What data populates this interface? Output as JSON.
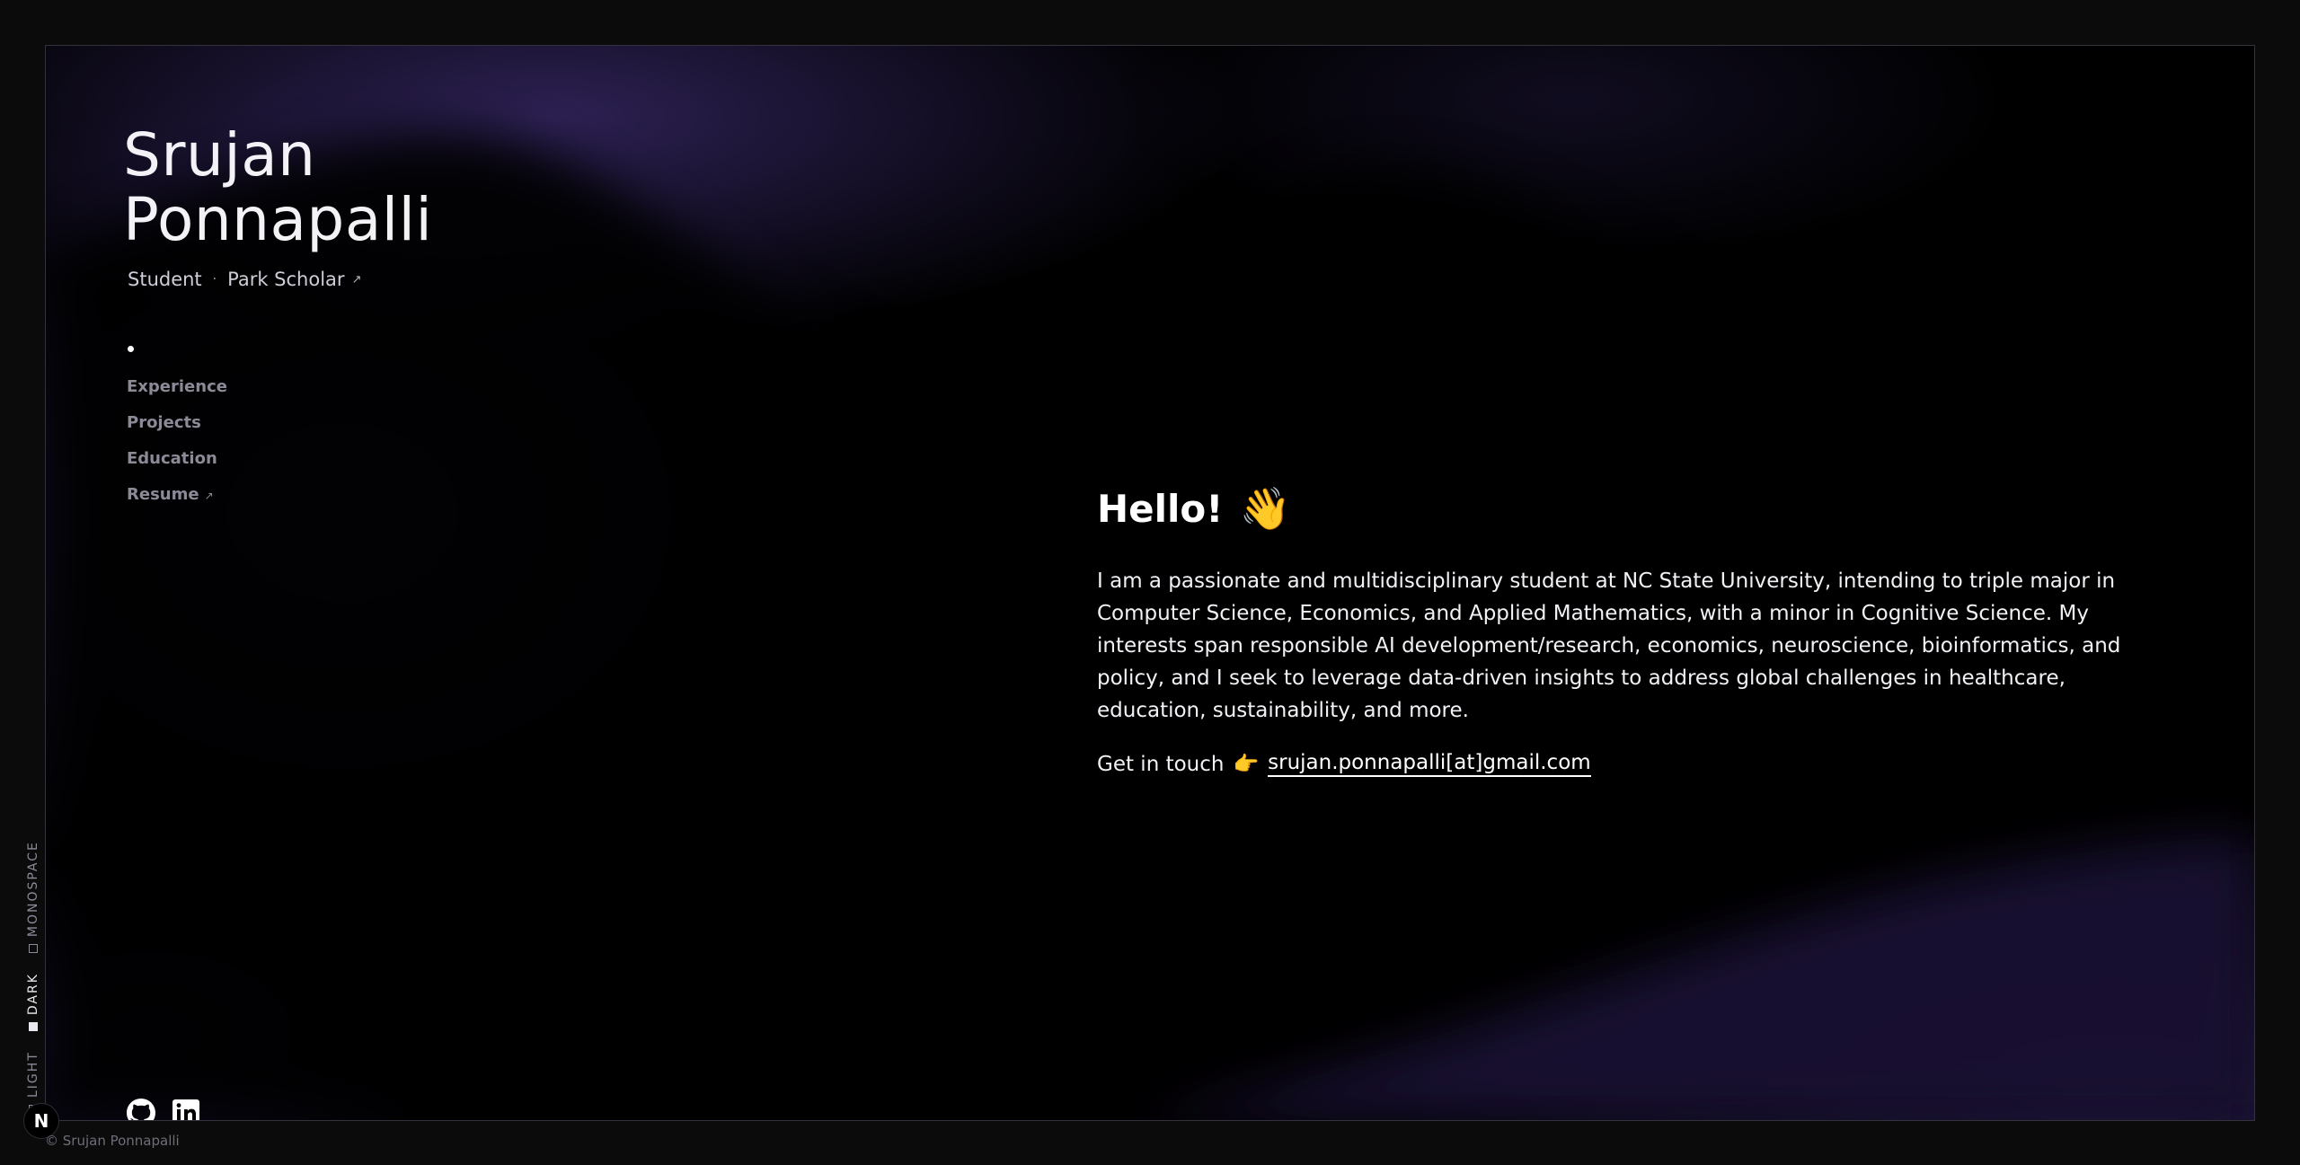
{
  "header": {
    "first_name": "Srujan",
    "last_name": "Ponnapalli",
    "role": "Student",
    "separator": "·",
    "affiliation": "Park Scholar",
    "external_icon": "↗"
  },
  "nav": {
    "items": [
      {
        "label": "Experience"
      },
      {
        "label": "Projects"
      },
      {
        "label": "Education"
      },
      {
        "label": "Resume",
        "external": "↗"
      }
    ]
  },
  "main": {
    "greeting": "Hello!",
    "greeting_emoji": "👋",
    "intro": "I am a passionate and multidisciplinary student at NC State University, intending to triple major in Computer Science, Economics, and Applied Mathematics, with a minor in Cognitive Science. My interests span responsible AI development/research, economics, neuroscience, bioinformatics, and policy, and I seek to leverage data-driven insights to address global challenges in healthcare, education, sustainability, and more.",
    "contact_label": "Get in touch",
    "contact_emoji": "👉",
    "email": "srujan.ponnapalli[at]gmail.com"
  },
  "social": {
    "icons": [
      "github-icon",
      "linkedin-icon"
    ]
  },
  "theme_switcher": {
    "options": [
      {
        "label": "LIGHT",
        "selected": false
      },
      {
        "label": "DARK",
        "selected": true
      },
      {
        "label": "MONOSPACE",
        "selected": false
      }
    ]
  },
  "badge": {
    "letter": "N"
  },
  "footer": {
    "copyright": "© Srujan Ponnapalli"
  },
  "colors": {
    "background": "#000000",
    "accent_purple": "#3a2a6e",
    "text": "#f2f1f6",
    "muted": "#8d8a98"
  }
}
